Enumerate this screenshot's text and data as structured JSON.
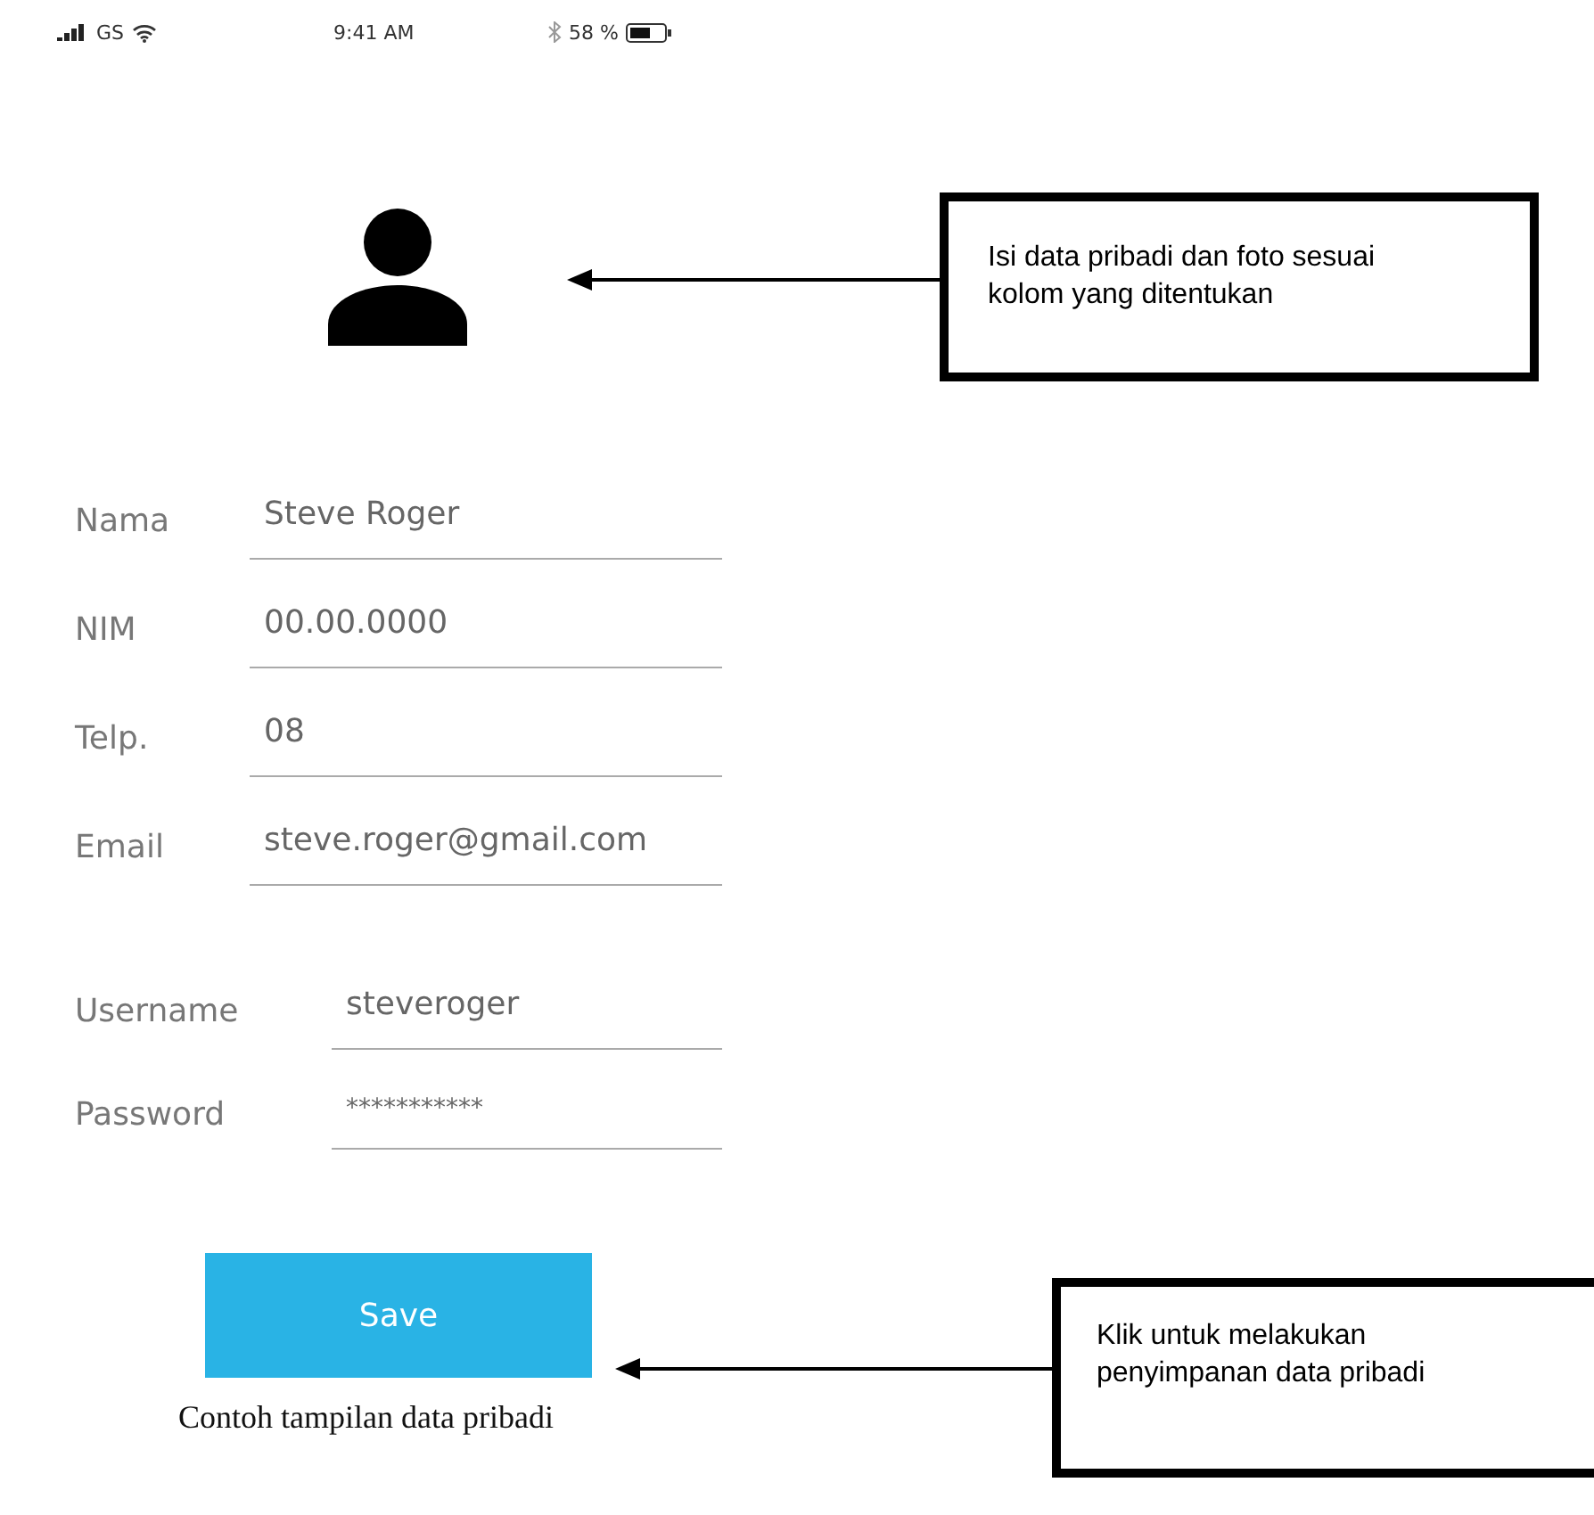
{
  "status_bar": {
    "carrier": "GS",
    "time": "9:41 AM",
    "battery": "58 %"
  },
  "form": {
    "fields": [
      {
        "label": "Nama",
        "value": "Steve Roger"
      },
      {
        "label": "NIM",
        "value": "00.00.0000"
      },
      {
        "label": "Telp.",
        "value": "08"
      },
      {
        "label": "Email",
        "value": "steve.roger@gmail.com"
      }
    ],
    "account_fields": [
      {
        "label": "Username",
        "value": "steveroger"
      },
      {
        "label": "Password",
        "value": "***********"
      }
    ],
    "save_button": "Save"
  },
  "callouts": [
    {
      "text": "Isi data pribadi dan foto sesuai kolom yang ditentukan"
    },
    {
      "text": "Klik untuk melakukan penyimpanan data pribadi"
    }
  ],
  "caption": "Contoh tampilan data pribadi"
}
